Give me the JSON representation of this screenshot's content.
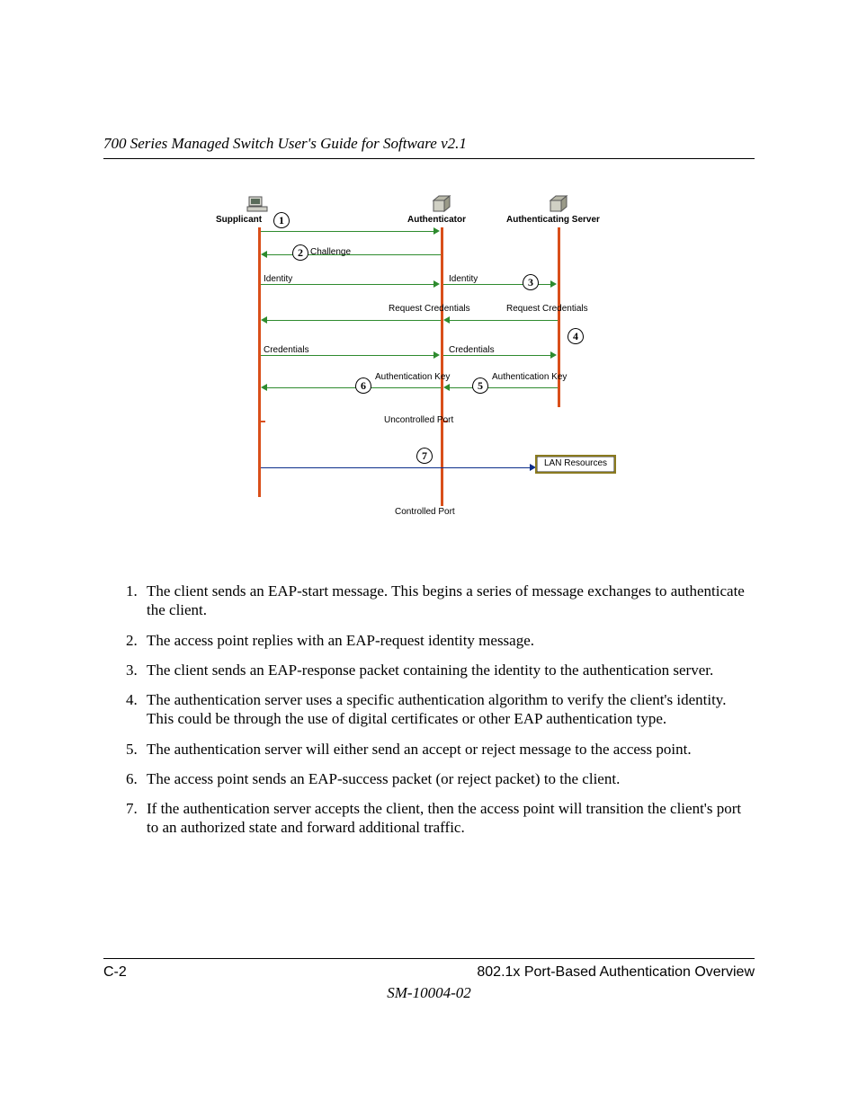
{
  "header": {
    "title": "700 Series Managed Switch User's Guide for Software v2.1"
  },
  "diagram": {
    "roles": {
      "supplicant": "Supplicant",
      "authenticator": "Authenticator",
      "server": "Authenticating Server"
    },
    "steps": {
      "n1": "1",
      "n2": "2",
      "n3": "3",
      "n4": "4",
      "n5": "5",
      "n6": "6",
      "n7": "7"
    },
    "labels": {
      "challenge": "Challenge",
      "identity_left": "Identity",
      "identity_right": "Identity",
      "req_cred_left": "Request\nCredentials",
      "req_cred_right": "Request\nCredentials",
      "cred_left": "Credentials",
      "cred_right": "Credentials",
      "authkey_left": "Authentication\nKey",
      "authkey_right": "Authentication\nKey",
      "uncontrolled": "Uncontrolled Port",
      "controlled": "Controlled Port",
      "lan": "LAN\nResources"
    }
  },
  "list": {
    "i1": "The client sends an EAP-start message. This begins a series of message exchanges to authenticate the client.",
    "i2": "The access point replies with an EAP-request identity message.",
    "i3": "The client sends an EAP-response packet containing the identity to the authentication server.",
    "i4": "The authentication server uses a specific authentication algorithm to verify the client's identity. This could be through the use of digital certificates or other EAP authentication type.",
    "i5": "The authentication server will either send an accept or reject message to the access point.",
    "i6": "The access point sends an EAP-success packet (or reject packet) to the client.",
    "i7": "If the authentication server accepts the client, then the access point will transition the client's port to an authorized state and forward additional traffic."
  },
  "footer": {
    "page": "C-2",
    "section": "802.1x Port-Based Authentication Overview",
    "docid": "SM-10004-02"
  }
}
